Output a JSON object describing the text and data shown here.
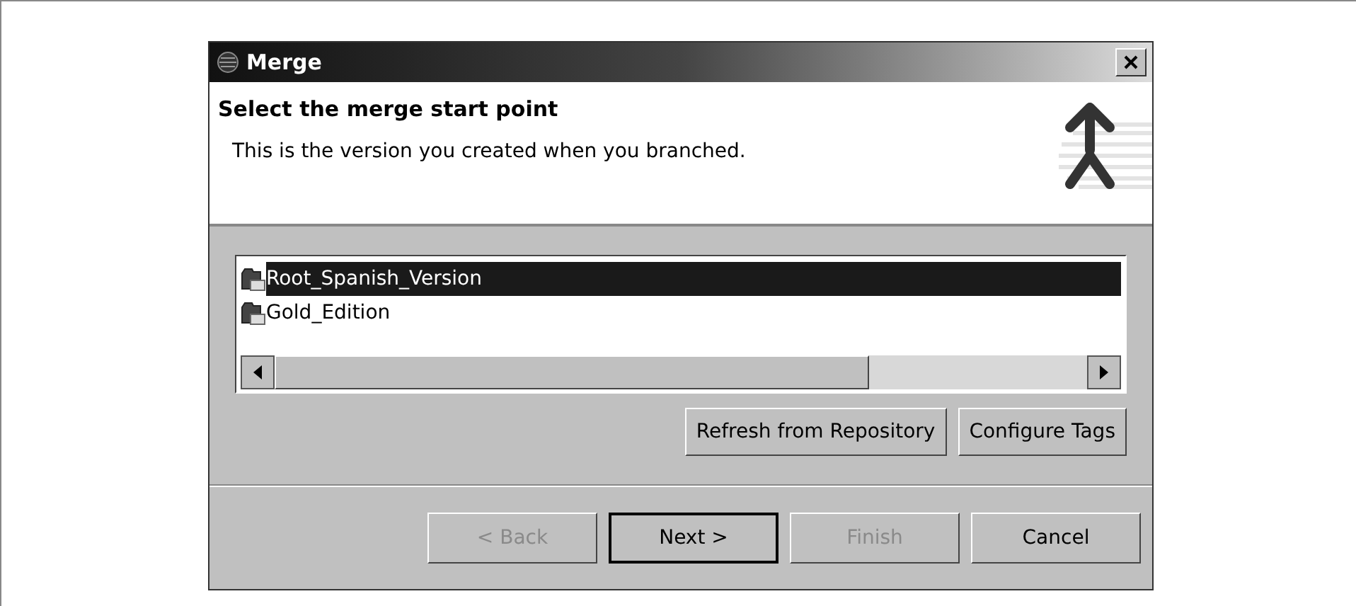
{
  "window": {
    "title": "Merge"
  },
  "header": {
    "title": "Select the merge start point",
    "description": "This is the version you created when you branched."
  },
  "tags": [
    {
      "label": "Root_Spanish_Version",
      "selected": true
    },
    {
      "label": "Gold_Edition",
      "selected": false
    }
  ],
  "list_buttons": [
    "Refresh from Repository",
    "Configure Tags"
  ],
  "buttons": [
    {
      "label": "< Back",
      "disabled": true,
      "default": false
    },
    {
      "label": "Next >",
      "disabled": false,
      "default": true
    },
    {
      "label": "Finish",
      "disabled": true,
      "default": false
    },
    {
      "label": "Cancel",
      "disabled": false,
      "default": false
    }
  ]
}
